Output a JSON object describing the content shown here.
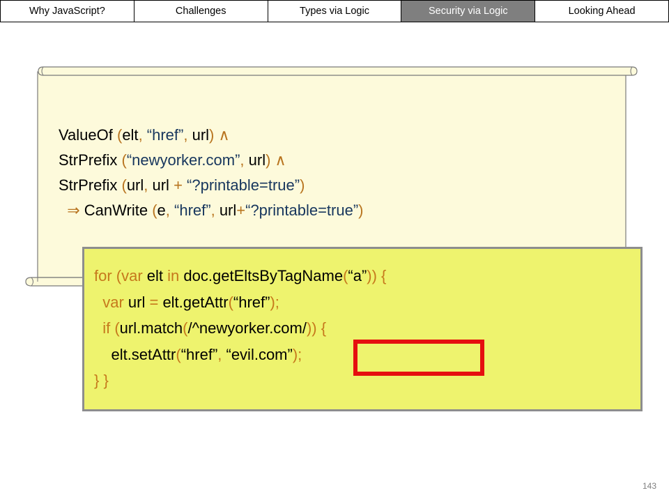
{
  "nav": {
    "tabs": [
      {
        "label": "Why JavaScript?",
        "active": false
      },
      {
        "label": "Challenges",
        "active": false
      },
      {
        "label": "Types via Logic",
        "active": false
      },
      {
        "label": "Security via Logic",
        "active": true
      },
      {
        "label": "Looking Ahead",
        "active": false
      }
    ]
  },
  "formula": {
    "line1": {
      "fn": "ValueOf",
      "open": " (",
      "a1": "elt",
      "comma1": ", ",
      "s1": "“href”",
      "comma2": ", ",
      "a2": "url",
      "close": ") ∧"
    },
    "line2": {
      "fn": "StrPrefix",
      "open": " (",
      "s1": "“newyorker.com”",
      "comma1": ", ",
      "a1": "url",
      "close": ") ∧"
    },
    "line3": {
      "fn": "StrPrefix",
      "open": " (",
      "a1": "url",
      "comma1": ", ",
      "a2": "url",
      "plus": " + ",
      "s1": "“?printable=true”",
      "close": ")"
    },
    "line4": {
      "arrow": "⇒ ",
      "fn": "CanWrite",
      "open": " (",
      "a1": "e",
      "comma1": ", ",
      "s1": "“href”",
      "comma2": ", ",
      "a2": "url",
      "plus": "+",
      "s2": "“?printable=true”",
      "close": ")"
    }
  },
  "code": {
    "line1": {
      "kw1": "for (var ",
      "t1": "elt",
      "kw2": " in ",
      "t2": "doc.getEltsByTagName",
      "kw3": "(",
      "t3": "“a”",
      "kw4": ")) {"
    },
    "line2": {
      "kw1": "  var ",
      "t1": "url",
      "kw2": " = ",
      "t2": "elt.getAttr",
      "kw3": "(",
      "t3": "“href”",
      "kw4": ");"
    },
    "line3": {
      "kw1": "  if (",
      "t1": "url.match",
      "kw2": "(",
      "t2": "/^newyorker.com/",
      "kw3": ")) {"
    },
    "line4": {
      "kw1": "    ",
      "t1": "elt.setAttr",
      "kw2": "(",
      "t2": "“href”",
      "kw3": ", ",
      "t3": "“evil.com”",
      "kw4": ");"
    },
    "line5": {
      "kw1": "} }"
    }
  },
  "page_number": "143"
}
